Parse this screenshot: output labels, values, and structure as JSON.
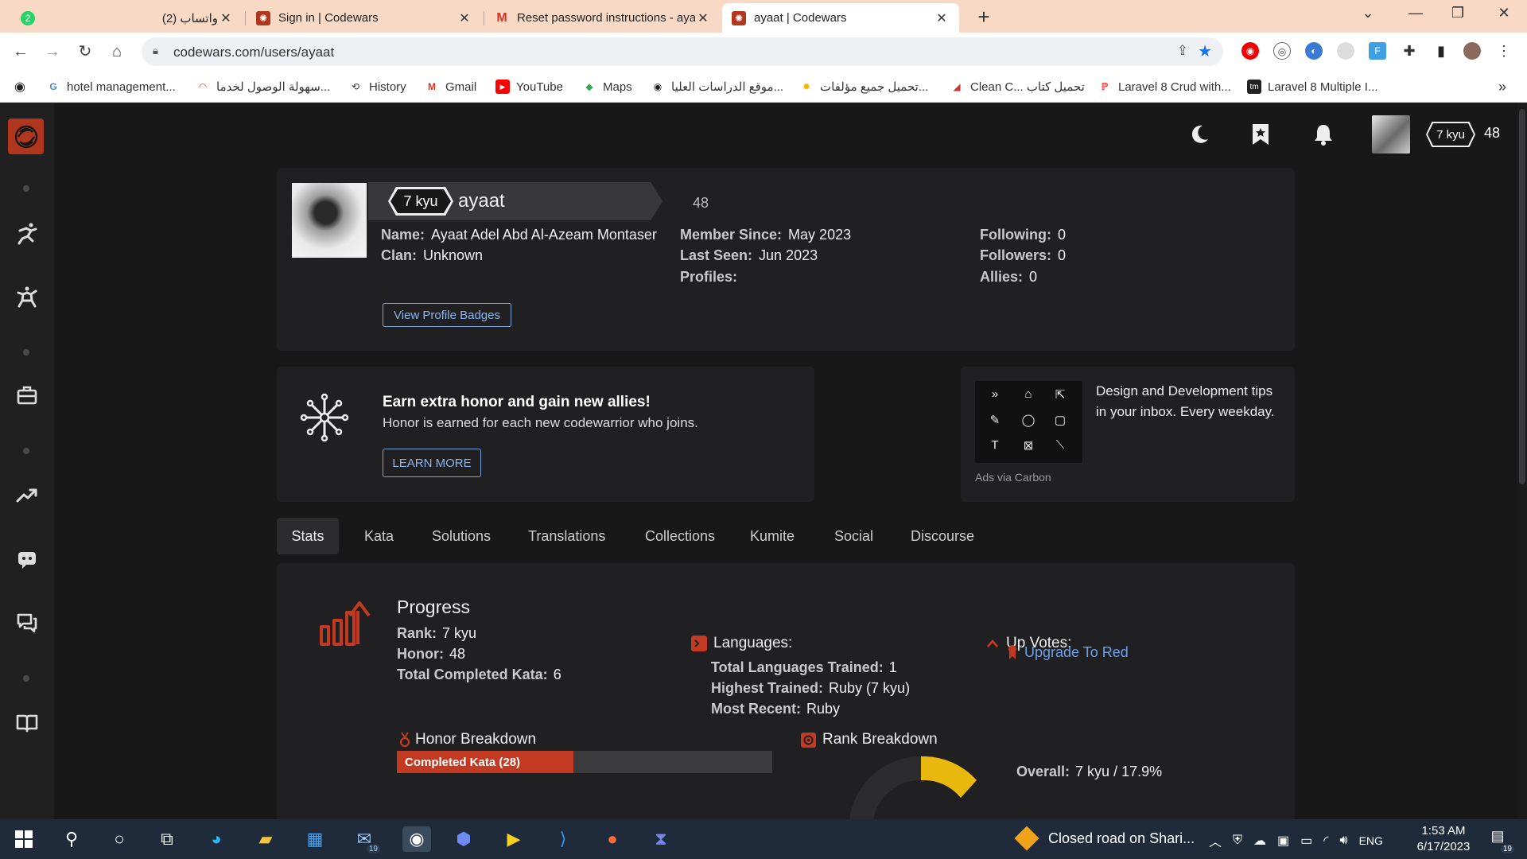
{
  "browser": {
    "tabs": [
      {
        "title": "واتساب (2)",
        "active": false
      },
      {
        "title": "Sign in | Codewars",
        "active": false
      },
      {
        "title": "Reset password instructions - aya",
        "active": false
      },
      {
        "title": "ayaat | Codewars",
        "active": true
      }
    ],
    "whatsapp_badge": "2",
    "url": "codewars.com/users/ayaat",
    "bookmarks": [
      "hotel management...",
      "سهولة الوصول لخدما...",
      "History",
      "Gmail",
      "YouTube",
      "Maps",
      "موقع الدراسات العليا...",
      "تحميل جميع مؤلفات...",
      "Clean C... تحميل كتاب",
      "Laravel 8 Crud with...",
      "Laravel 8 Multiple I..."
    ],
    "bookmarks_more": "»"
  },
  "header": {
    "rank": "7 kyu",
    "honor": "48"
  },
  "profile": {
    "rank": "7 kyu",
    "username": "ayaat",
    "honor": "48",
    "fields_left": [
      {
        "label": "Name:",
        "value": "Ayaat Adel Abd Al-Azeam Montaser"
      },
      {
        "label": "Clan:",
        "value": "Unknown"
      }
    ],
    "fields_middle": [
      {
        "label": "Member Since:",
        "value": "May 2023"
      },
      {
        "label": "Last Seen:",
        "value": "Jun 2023"
      },
      {
        "label": "Profiles:",
        "value": ""
      }
    ],
    "fields_right": [
      {
        "label": "Following:",
        "value": "0"
      },
      {
        "label": "Followers:",
        "value": "0"
      },
      {
        "label": "Allies:",
        "value": "0"
      }
    ],
    "badges_button": "View Profile Badges"
  },
  "promo": {
    "title": "Earn extra honor and gain new allies!",
    "subtitle": "Honor is earned for each new codewarrior who joins.",
    "button": "LEARN MORE"
  },
  "ad": {
    "text": "Design and Development tips in your inbox. Every weekday.",
    "via": "Ads via Carbon"
  },
  "profile_tabs": [
    "Stats",
    "Kata",
    "Solutions",
    "Translations",
    "Collections",
    "Kumite",
    "Social",
    "Discourse"
  ],
  "stats": {
    "progress_title": "Progress",
    "progress": [
      {
        "label": "Rank:",
        "value": "7 kyu"
      },
      {
        "label": "Honor:",
        "value": "48"
      },
      {
        "label": "Total Completed Kata:",
        "value": "6"
      }
    ],
    "languages_title": "Languages:",
    "languages": [
      {
        "label": "Total Languages Trained:",
        "value": "1"
      },
      {
        "label": "Highest Trained:",
        "value": "Ruby (7 kyu)"
      },
      {
        "label": "Most Recent:",
        "value": "Ruby"
      }
    ],
    "upvotes_title": "Up Votes:",
    "upgrade_link": "Upgrade To Red",
    "honor_breakdown_title": "Honor Breakdown",
    "honor_breakdown_bar": {
      "label": "Completed Kata (28)",
      "fraction": 0.47
    },
    "rank_breakdown_title": "Rank Breakdown",
    "overall": {
      "label": "Overall:",
      "value": "7 kyu / 17.9%"
    },
    "colors": {
      "accent": "#c33a22",
      "rank_yellow": "#e9b80e",
      "link": "#6ea0e8"
    }
  },
  "taskbar": {
    "weather": "Closed road on Shari...",
    "language": "ENG",
    "time": "1:53 AM",
    "date": "6/17/2023",
    "mail_badge": "19",
    "notif_badge": "19"
  }
}
